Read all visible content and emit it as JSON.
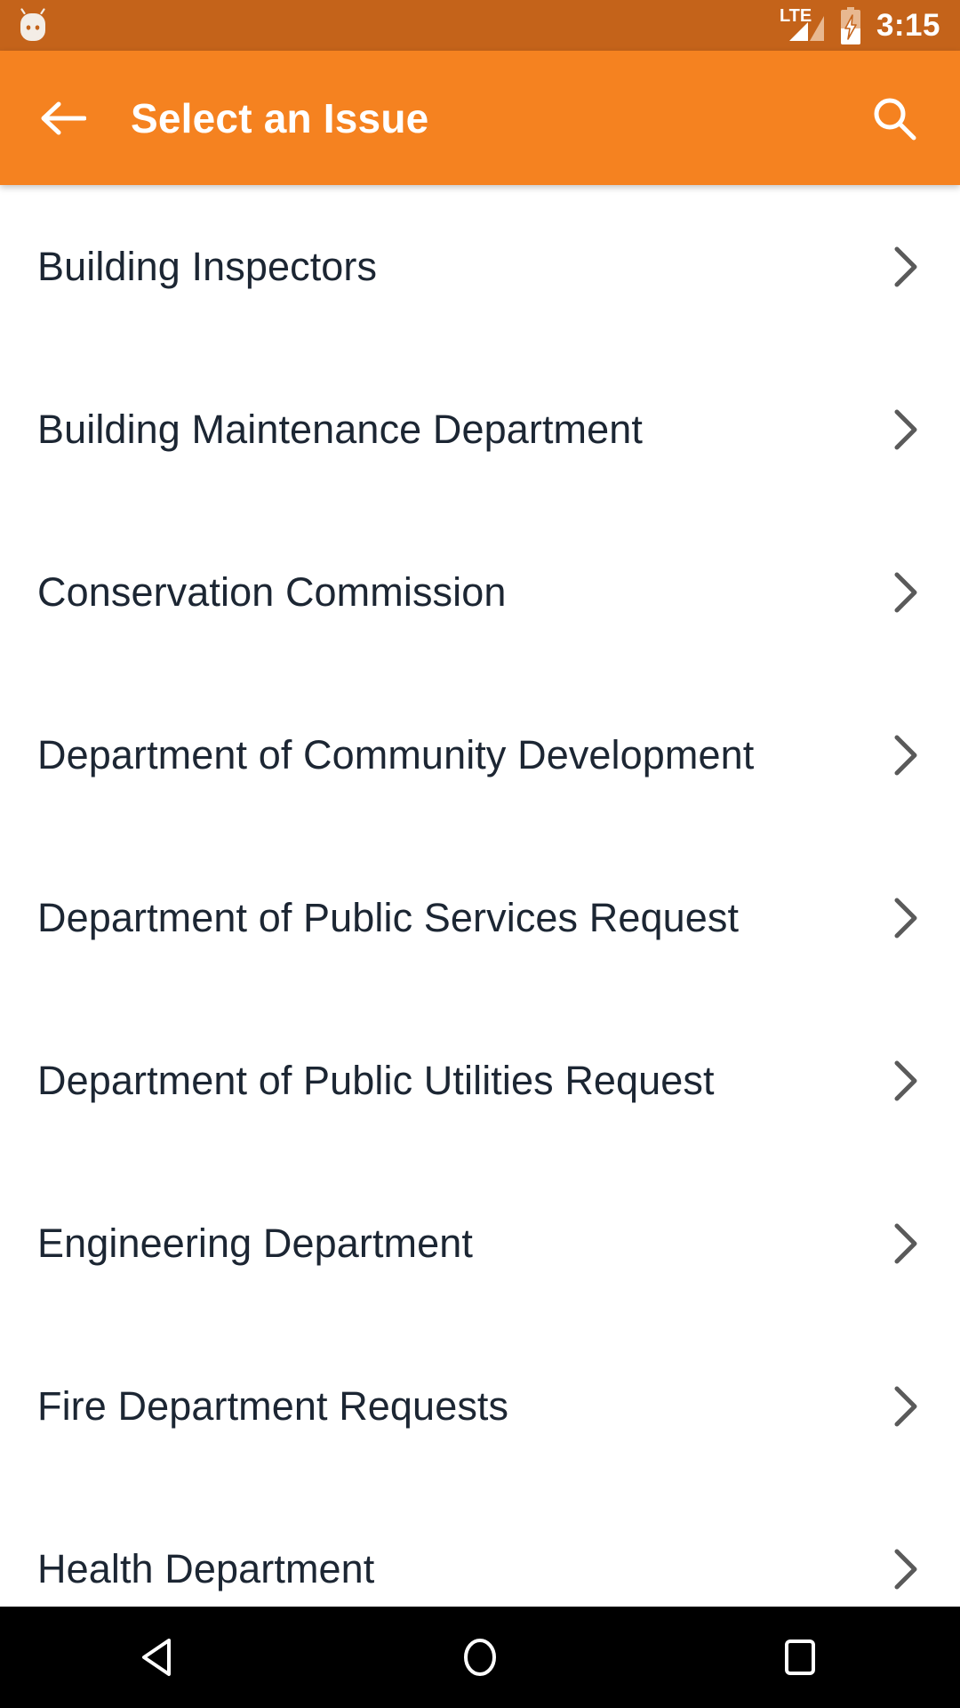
{
  "status_bar": {
    "notification_icon": "android-mascot-icon",
    "network_type": "LTE",
    "signal_icon": "signal-bars-icon",
    "battery_icon": "battery-charging-icon",
    "time": "3:15",
    "background_color": "#C4631A",
    "foreground_color": "#FFFFFF"
  },
  "app_bar": {
    "back_icon": "arrow-left-icon",
    "title": "Select an Issue",
    "search_icon": "search-icon",
    "background_color": "#F58220",
    "title_color": "#FFFFFF"
  },
  "list": {
    "chevron_icon": "chevron-right-icon",
    "item_text_color": "#1C2633",
    "chevron_color": "#5A5A5A",
    "items": [
      {
        "label": "Building Inspectors"
      },
      {
        "label": "Building Maintenance Department"
      },
      {
        "label": "Conservation Commission"
      },
      {
        "label": "Department of Community Development"
      },
      {
        "label": "Department of Public Services Request"
      },
      {
        "label": "Department of Public Utilities Request"
      },
      {
        "label": "Engineering Department"
      },
      {
        "label": "Fire Department Requests"
      },
      {
        "label": "Health Department"
      }
    ]
  },
  "nav_bar": {
    "background_color": "#000000",
    "buttons": [
      {
        "name": "back",
        "icon": "triangle-back-icon"
      },
      {
        "name": "home",
        "icon": "circle-home-icon"
      },
      {
        "name": "recents",
        "icon": "square-recents-icon"
      }
    ]
  }
}
